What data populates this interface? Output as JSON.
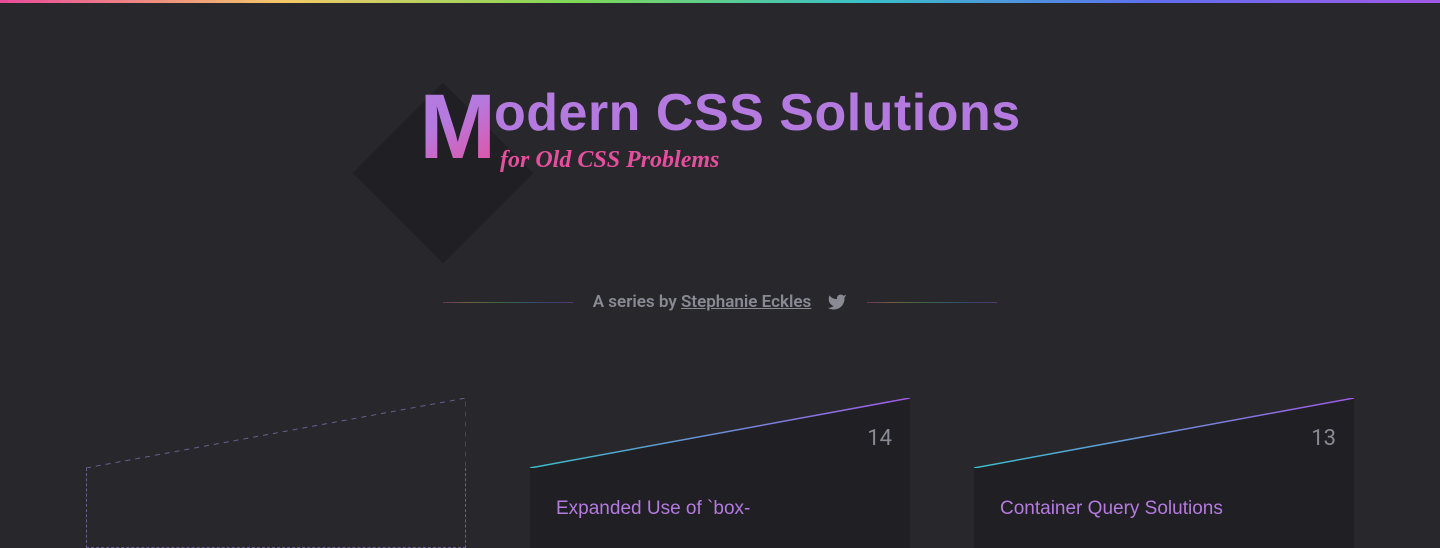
{
  "hero": {
    "first_letter": "M",
    "title_rest": "odern CSS Solutions",
    "subtitle": "for Old CSS Problems"
  },
  "byline": {
    "prefix": "A series by ",
    "author": "Stephanie Eckles"
  },
  "cards": [
    {
      "number": "",
      "title": ""
    },
    {
      "number": "14",
      "title": "Expanded Use of `box-"
    },
    {
      "number": "13",
      "title": "Container Query Solutions"
    }
  ]
}
